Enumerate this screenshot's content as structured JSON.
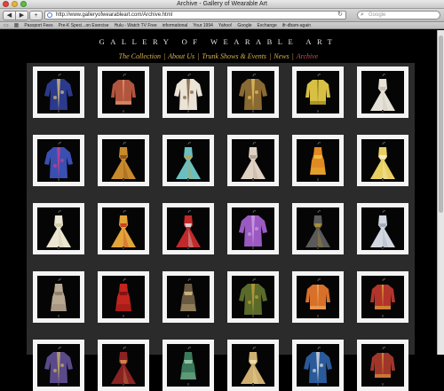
{
  "window": {
    "title": "Archive - Gallery of Wearable Art"
  },
  "toolbar": {
    "back_icon": "back-arrow-icon",
    "forward_icon": "forward-arrow-icon",
    "add_icon": "plus-icon",
    "url": "http://www.galleryofwearableart.com/Archive.html",
    "search_placeholder": "Google"
  },
  "bookmarks": [
    "Passport Fees",
    "Pre-K Speci...on Exercise",
    "Hulu - Watch TV Free",
    "informational",
    "Your 1994",
    "Yahoo!",
    "Google",
    "Exchange",
    "ifr-dbam-again"
  ],
  "site": {
    "title": "GALLERY OF WEARABLE ART",
    "nav": [
      {
        "label": "The Collection"
      },
      {
        "label": "About Us"
      },
      {
        "label": "Trunk Shows & Events"
      },
      {
        "label": "News"
      },
      {
        "label": "Archive",
        "active": true
      }
    ],
    "nav_color": "#d9b24a",
    "active_color": "#c94b5a"
  },
  "gallery": {
    "columns": 6,
    "tiles": [
      {
        "kind": "robe",
        "color": "#2b3a8c",
        "accent": "#d6c17a"
      },
      {
        "kind": "jacket",
        "color": "#b2553e",
        "accent": "#e2a27a"
      },
      {
        "kind": "robe",
        "color": "#eae3d6",
        "accent": "#7a5a3a"
      },
      {
        "kind": "robe",
        "color": "#8a6a32",
        "accent": "#e5c35c"
      },
      {
        "kind": "jacket",
        "color": "#d8c044",
        "accent": "#8c7a1a"
      },
      {
        "kind": "gown",
        "color": "#e6e2d8",
        "accent": "#c7c1b2"
      },
      {
        "kind": "robe",
        "color": "#3a4fb2",
        "accent": "#d23c8c"
      },
      {
        "kind": "gown",
        "color": "#c88a2c",
        "accent": "#8a4e18"
      },
      {
        "kind": "gown",
        "color": "#6ac0c0",
        "accent": "#c2a24a"
      },
      {
        "kind": "gown",
        "color": "#e0d2c2",
        "accent": "#b0a090"
      },
      {
        "kind": "dress",
        "color": "#e18a22",
        "accent": "#f2c23c"
      },
      {
        "kind": "gown",
        "color": "#e8cf62",
        "accent": "#f6f0d0"
      },
      {
        "kind": "gown",
        "color": "#ece6d0",
        "accent": "#cfc7a6"
      },
      {
        "kind": "gown",
        "color": "#e2a43a",
        "accent": "#c23a22"
      },
      {
        "kind": "gown",
        "color": "#c02a2a",
        "accent": "#e0e0e0"
      },
      {
        "kind": "robe",
        "color": "#9a5ac2",
        "accent": "#d0a0e6"
      },
      {
        "kind": "gown",
        "color": "#5a5a5a",
        "accent": "#b0962c"
      },
      {
        "kind": "gown",
        "color": "#d2d8e2",
        "accent": "#a0a8b6"
      },
      {
        "kind": "dress",
        "color": "#b8a894",
        "accent": "#8a7a64"
      },
      {
        "kind": "dress",
        "color": "#c2241e",
        "accent": "#7a1010"
      },
      {
        "kind": "dress",
        "color": "#6a5a42",
        "accent": "#d8c086"
      },
      {
        "kind": "robe",
        "color": "#5a6a2a",
        "accent": "#c2a23c"
      },
      {
        "kind": "jacket",
        "color": "#d8702a",
        "accent": "#f0b06a"
      },
      {
        "kind": "jacket",
        "color": "#b2342a",
        "accent": "#e2b23c"
      },
      {
        "kind": "robe",
        "color": "#5a4a8a",
        "accent": "#c8b060"
      },
      {
        "kind": "gown",
        "color": "#8a2222",
        "accent": "#d09050"
      },
      {
        "kind": "dress",
        "color": "#3a7a5a",
        "accent": "#a0d0b0"
      },
      {
        "kind": "gown",
        "color": "#d0b070",
        "accent": "#f0e0b0"
      },
      {
        "kind": "robe",
        "color": "#2a5a9a",
        "accent": "#e0e0e0"
      },
      {
        "kind": "jacket",
        "color": "#a0362a",
        "accent": "#e0a040"
      }
    ]
  }
}
